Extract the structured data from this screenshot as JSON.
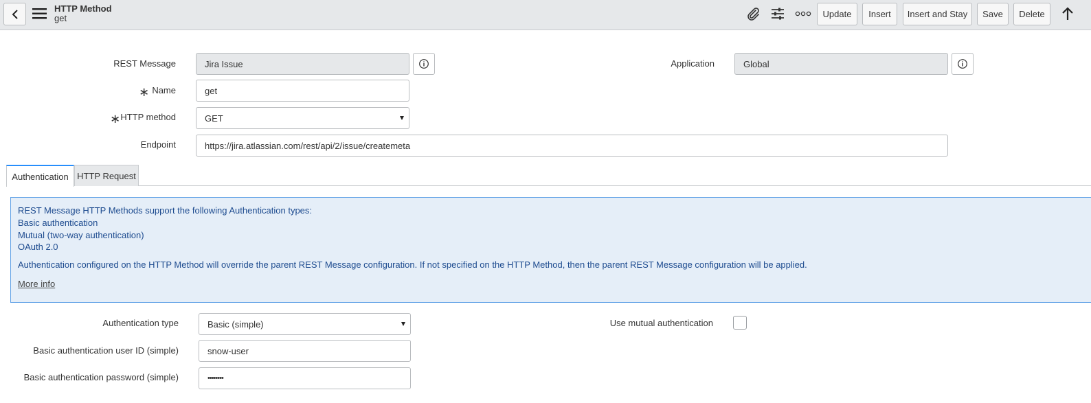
{
  "header": {
    "title": "HTTP Method",
    "subtitle": "get",
    "buttons": {
      "update": "Update",
      "insert": "Insert",
      "insert_and_stay": "Insert and Stay",
      "save": "Save",
      "delete": "Delete"
    }
  },
  "form": {
    "rest_message": {
      "label": "REST Message",
      "value": "Jira Issue"
    },
    "application": {
      "label": "Application",
      "value": "Global"
    },
    "name": {
      "label": "Name",
      "value": "get"
    },
    "http_method": {
      "label": "HTTP method",
      "value": "GET"
    },
    "endpoint": {
      "label": "Endpoint",
      "value": "https://jira.atlassian.com/rest/api/2/issue/createmeta"
    },
    "required_mark": "∗"
  },
  "tabs": [
    {
      "label": "Authentication"
    },
    {
      "label": "HTTP Request"
    }
  ],
  "info": {
    "heading": "REST Message HTTP Methods support the following Authentication types:",
    "types": [
      "Basic authentication",
      "Mutual (two-way authentication)",
      "OAuth 2.0"
    ],
    "note": "Authentication configured on the HTTP Method will override the parent REST Message configuration. If not specified on the HTTP Method, then the parent REST Message configuration will be applied.",
    "more_info": "More info"
  },
  "auth": {
    "auth_type": {
      "label": "Authentication type",
      "value": "Basic (simple)"
    },
    "mutual": {
      "label": "Use mutual authentication"
    },
    "user_id": {
      "label": "Basic authentication user ID (simple)",
      "value": "snow-user"
    },
    "password": {
      "label": "Basic authentication password (simple)",
      "value": "••••••••"
    }
  },
  "colors": {
    "accent": "#278efc",
    "info_bg": "#e5eef8",
    "info_text": "#1d4b8f"
  }
}
